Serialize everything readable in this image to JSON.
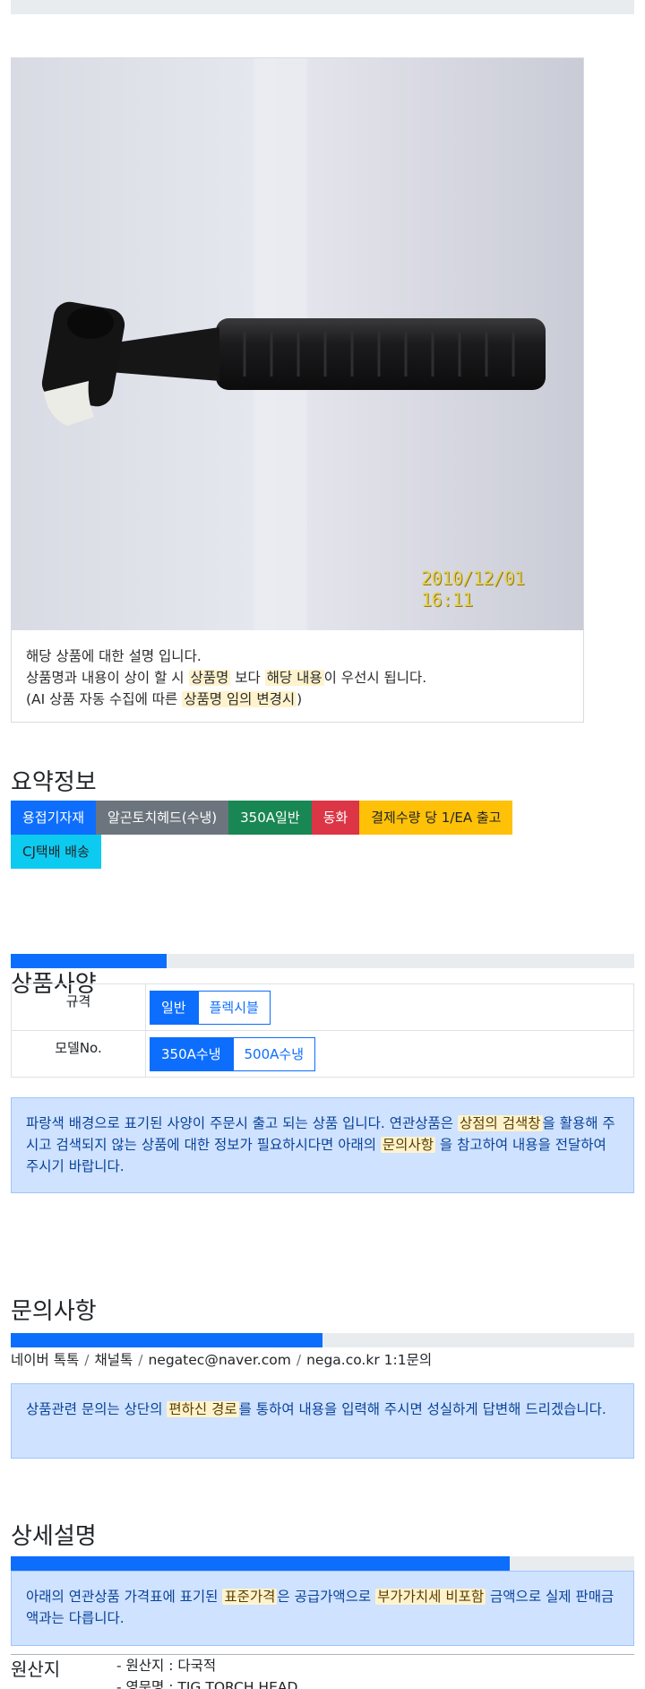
{
  "description": {
    "line1": "해당 상품에 대한 설명 입니다.",
    "line2_pre": "상품명과 내용이 상이 할 시 ",
    "line2_hl1": "상품명",
    "line2_mid": " 보다 ",
    "line2_hl2": "해당 내용",
    "line2_post": "이 우선시 됩니다.",
    "line3_pre": "(AI 상품 자동 수집에 따른 ",
    "line3_hl": "상품명 임의 변경시",
    "line3_post": ")"
  },
  "photo": {
    "timestamp": "2010/12/01 16:11"
  },
  "summary": {
    "title": "요약정보",
    "badges": [
      {
        "label": "용접기자재",
        "color": "#0d6efd"
      },
      {
        "label": "알곤토치헤드(수냉)",
        "color": "#6c757d"
      },
      {
        "label": "350A일반",
        "color": "#198754"
      },
      {
        "label": "동화",
        "color": "#dc3545"
      },
      {
        "label": "결제수량 당 1/EA 출고",
        "color": "#ffc107"
      },
      {
        "label": "CJ택배 배송",
        "color": "#0dcaf0"
      }
    ]
  },
  "spec": {
    "title": "상품사양",
    "progress_fraction": 0.25,
    "rows": [
      {
        "label": "규격",
        "options": [
          "일반",
          "플렉시블"
        ],
        "selected": 0
      },
      {
        "label": "모델No.",
        "options": [
          "350A수냉",
          "500A수냉"
        ],
        "selected": 0
      }
    ],
    "notice_pre": "파랑색 배경으로 표기된 사양이 주문시 출고 되는 상품 입니다. 연관상품은 ",
    "notice_hl1": "상점의 검색창",
    "notice_mid": "을 활용해 주시고 검색되지 않는 상품에 대한 정보가 필요하시다면 아래의 ",
    "notice_hl2": "문의사항",
    "notice_post": " 을 참고하여 내용을 전달하여 주시기 바랍니다."
  },
  "inquiry": {
    "title": "문의사항",
    "progress_fraction": 0.5,
    "links": [
      "네이버 톡톡",
      "채널톡",
      "negatec@naver.com",
      "nega.co.kr 1:1문의"
    ],
    "notice_pre": "상품관련 문의는 상단의 ",
    "notice_hl": "편하신 경로",
    "notice_post": "를 통하여 내용을 입력해 주시면 성실하게 답변해 드리겠습니다."
  },
  "detail": {
    "title": "상세설명",
    "progress_fraction": 0.8,
    "notice_pre": "아래의 연관상품 가격표에 표기된 ",
    "notice_hl1": "표준가격",
    "notice_mid": "은 공급가액으로 ",
    "notice_hl2": "부가가치세 비포함",
    "notice_post": " 금액으로 실제 판매금액과는 다릅니다."
  },
  "origin": {
    "title": "원산지",
    "items": [
      "- 원산지 : 다국적",
      "- 영문명 : TIG TORCH HEAD"
    ]
  }
}
